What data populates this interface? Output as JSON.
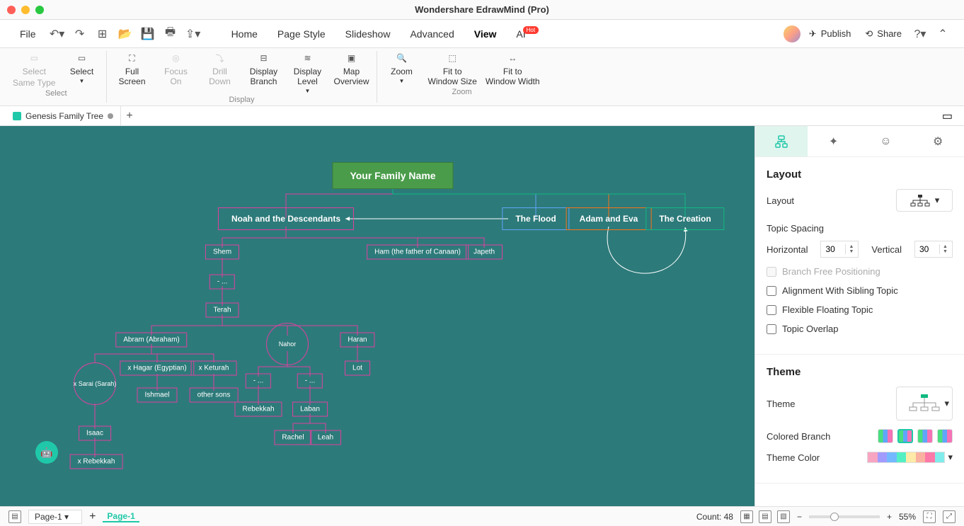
{
  "app": {
    "title": "Wondershare EdrawMind (Pro)"
  },
  "menu": {
    "file": "File",
    "items": [
      "Home",
      "Page Style",
      "Slideshow",
      "Advanced",
      "View",
      "AI"
    ],
    "active": "View",
    "hot": "Hot",
    "publish": "Publish",
    "share": "Share"
  },
  "ribbon": {
    "select": "Select",
    "sameType": "Same Type",
    "selectGroup": "Select",
    "fullScreen": "Full\nScreen",
    "focusOn": "Focus\nOn",
    "drillDown": "Drill\nDown",
    "displayBranch": "Display\nBranch",
    "displayLevel": "Display\nLevel",
    "mapOverview": "Map\nOverview",
    "displayGroup": "Display",
    "zoom": "Zoom",
    "fitWindowSize": "Fit to\nWindow Size",
    "fitWindowWidth": "Fit to\nWindow Width",
    "zoomGroup": "Zoom"
  },
  "tabs": {
    "doc": "Genesis Family Tree"
  },
  "nodes": {
    "root": "Your Family Name",
    "noah": "Noah and the Descendants",
    "flood": "The Flood",
    "adam": "Adam and Eva",
    "creation": "The Creation",
    "shem": "Shem",
    "ham": "Ham (the father of Canaan)",
    "japeth": "Japeth",
    "dash1": "- ...",
    "terah": "Terah",
    "abram": "Abram (Abraham)",
    "nahor": "Nahor",
    "haran": "Haran",
    "sarai": "x Sarai (Sarah)",
    "hagar": "x Hagar (Egyptian)",
    "keturah": "x Keturah",
    "ishmael": "Ishmael",
    "otherSons": "other sons",
    "dash2": "- ...",
    "dash3": "- ...",
    "lot": "Lot",
    "rebekkah": "Rebekkah",
    "laban": "Laban",
    "isaac": "Isaac",
    "xrebekkah": "x Rebekkah",
    "rachel": "Rachel",
    "leah": "Leah"
  },
  "panel": {
    "layout": "Layout",
    "layoutLabel": "Layout",
    "topicSpacing": "Topic Spacing",
    "horizontal": "Horizontal",
    "horizontalVal": "30",
    "vertical": "Vertical",
    "verticalVal": "30",
    "branchFree": "Branch Free Positioning",
    "alignSibling": "Alignment With Sibling Topic",
    "flexFloat": "Flexible Floating Topic",
    "topicOverlap": "Topic Overlap",
    "theme": "Theme",
    "themeLabel": "Theme",
    "coloredBranch": "Colored Branch",
    "themeColor": "Theme Color"
  },
  "status": {
    "pageSelect": "Page-1",
    "activePage": "Page-1",
    "count": "Count: 48",
    "zoom": "55%"
  }
}
